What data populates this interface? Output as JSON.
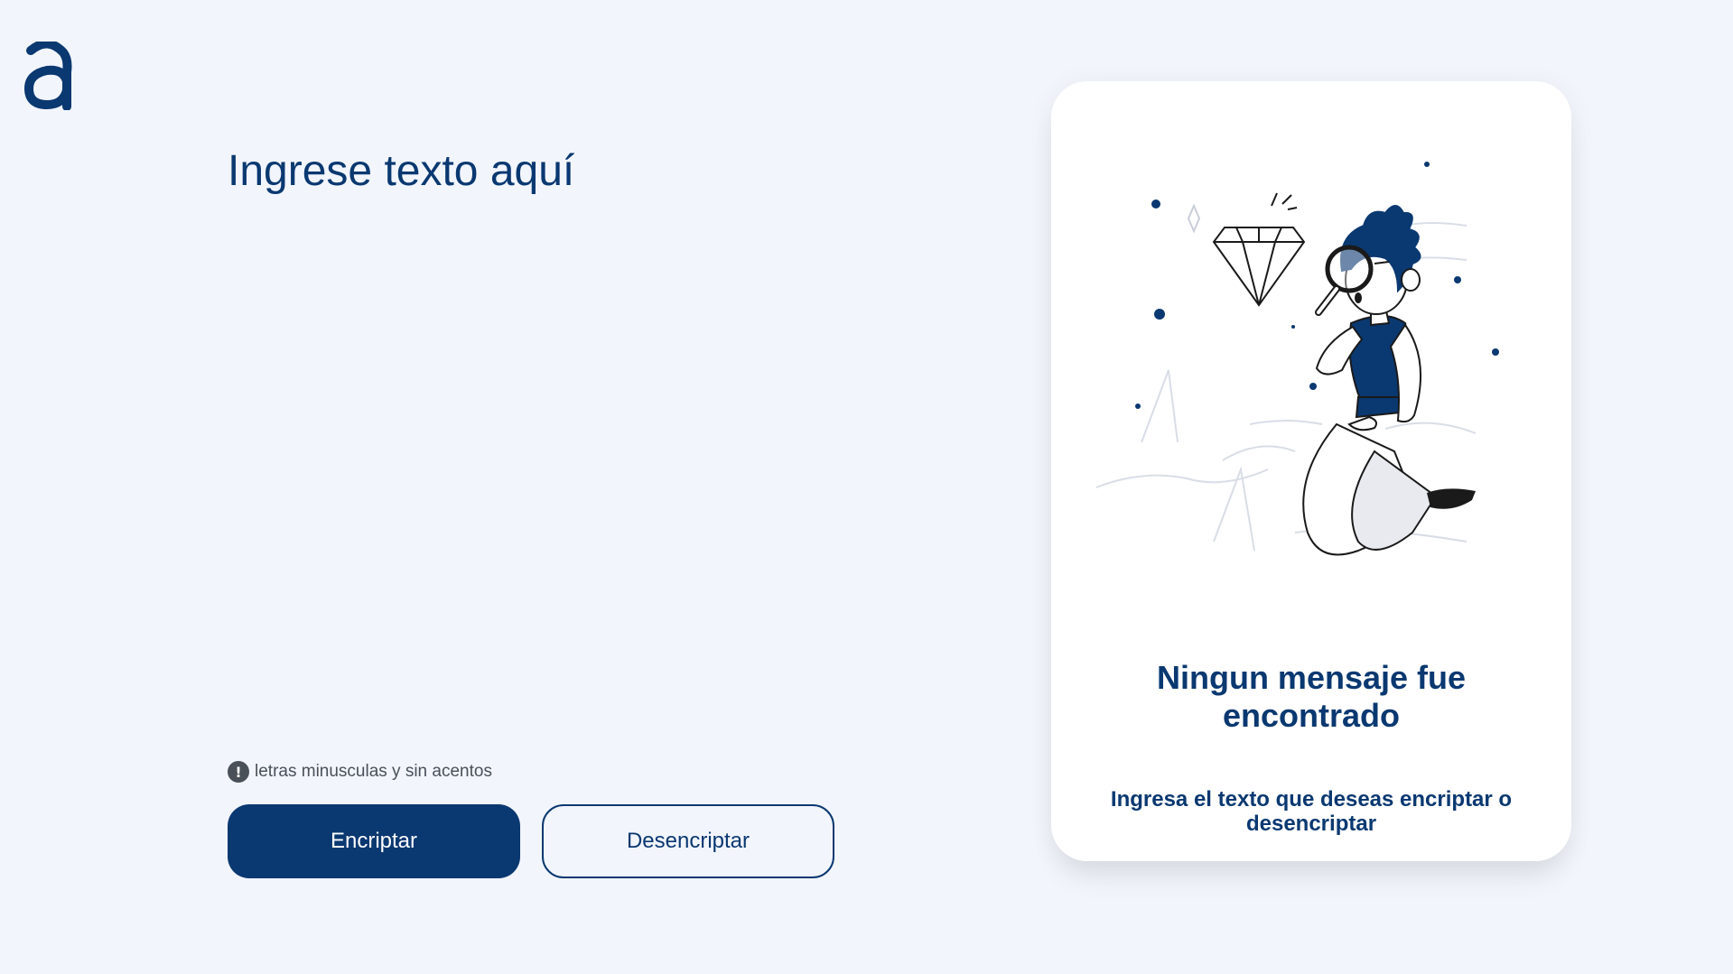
{
  "brand": {
    "logo_letter": "a",
    "accent": "#0a3871"
  },
  "input": {
    "placeholder": "Ingrese texto aquí",
    "value": ""
  },
  "hint": {
    "icon": "exclamation-circle-icon",
    "text": "letras minusculas y sin acentos"
  },
  "buttons": {
    "encrypt_label": "Encriptar",
    "decrypt_label": "Desencriptar"
  },
  "output": {
    "illustration": "person-with-magnifier-and-diamond",
    "title": "Ningun mensaje fue encontrado",
    "subtitle": "Ingresa el texto que deseas encriptar o desencriptar"
  },
  "colors": {
    "background": "#f2f5fc",
    "primary": "#0a3871",
    "card": "#ffffff",
    "hint": "#495057"
  }
}
